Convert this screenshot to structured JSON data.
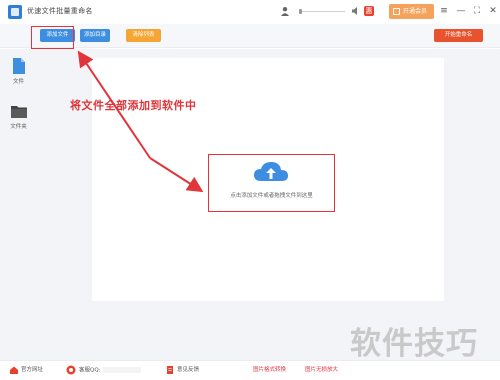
{
  "app": {
    "title": "优速文件批量重命名",
    "vip_label": "开通会员",
    "promo_badge": "惠"
  },
  "toolbar": {
    "add_file": "添加文件",
    "add_folder": "添加目录",
    "clear": "清除列表",
    "start": "开始重命名"
  },
  "sidebar": {
    "items": [
      {
        "label": "文件",
        "icon": "file-icon"
      },
      {
        "label": "文件夹",
        "icon": "folder-icon"
      }
    ]
  },
  "main": {
    "drop_hint": "点击添加文件或者拖拽文件到这里",
    "callout": "将文件全部添加到软件中"
  },
  "footer": {
    "website": "官方网址",
    "qq": "客服QQ:",
    "feedback": "意见反馈",
    "format_convert": "图片格式转换",
    "lossless_enlarge": "图片无损放大"
  },
  "watermark": "软件技巧",
  "colors": {
    "accent_blue": "#3d8de0",
    "orange": "#f4a532",
    "start_red": "#e8522c",
    "annotation_red": "#e0353a"
  }
}
